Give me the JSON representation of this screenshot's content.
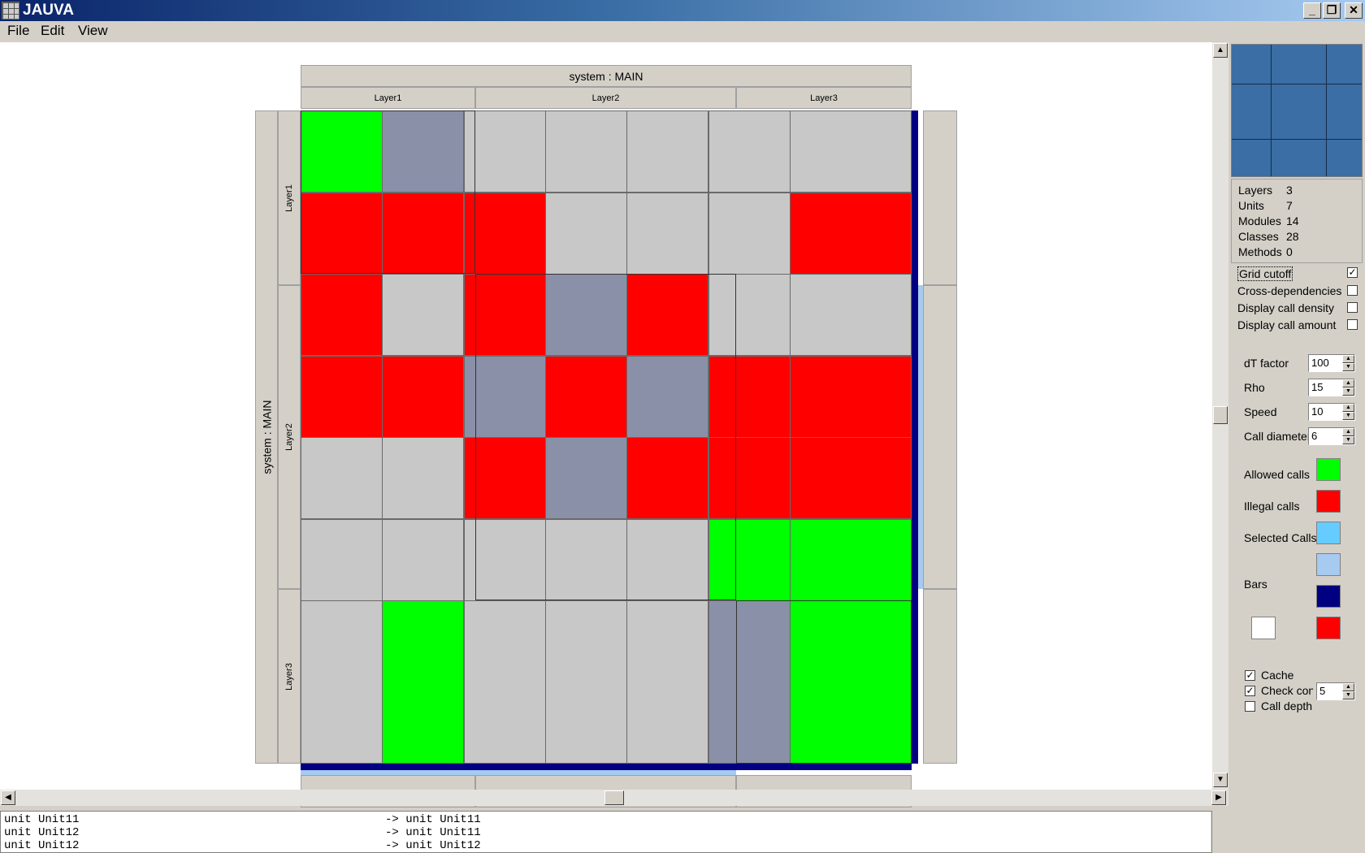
{
  "window": {
    "title": "JAUVA"
  },
  "menubar": {
    "items": [
      "File",
      "Edit",
      "View"
    ]
  },
  "matrix": {
    "system_title": "system : MAIN",
    "layers": [
      "Layer1",
      "Layer2",
      "Layer3"
    ],
    "cells": [
      [
        "allowed",
        "selected",
        "none",
        "none",
        "none",
        "none",
        "none"
      ],
      [
        "illegal",
        "illegal",
        "illegal",
        "none",
        "none",
        "none",
        "illegal"
      ],
      [
        "illegal",
        "none",
        "illegal",
        "selected",
        "illegal",
        "none",
        "none"
      ],
      [
        "illegal",
        "illegal",
        "selected",
        "illegal",
        "selected",
        "illegal",
        "illegal"
      ],
      [
        "none",
        "none",
        "illegal",
        "selected",
        "illegal",
        "illegal",
        "illegal"
      ],
      [
        "none",
        "none",
        "none",
        "none",
        "none",
        "allowed",
        "allowed"
      ],
      [
        "none",
        "allowed",
        "none",
        "none",
        "none",
        "selected",
        "allowed"
      ]
    ]
  },
  "stats": {
    "layers_label": "Layers",
    "layers_value": "3",
    "units_label": "Units",
    "units_value": "7",
    "modules_label": "Modules",
    "modules_value": "14",
    "classes_label": "Classes",
    "classes_value": "28",
    "methods_label": "Methods",
    "methods_value": "0"
  },
  "options": {
    "grid_cutoff": {
      "label": "Grid cutoff",
      "checked": true
    },
    "cross_dependencies": {
      "label": "Cross-dependencies",
      "checked": false
    },
    "display_call_density": {
      "label": "Display call density",
      "checked": false
    },
    "display_call_amount": {
      "label": "Display call amount",
      "checked": false
    }
  },
  "params": {
    "dt_factor": {
      "label": "dT factor",
      "value": "100"
    },
    "rho": {
      "label": "Rho",
      "value": "15"
    },
    "speed": {
      "label": "Speed",
      "value": "10"
    },
    "call_diameter": {
      "label": "Call diameter",
      "value": "6"
    }
  },
  "colors_panel": {
    "allowed_label": "Allowed calls",
    "illegal_label": "Illegal calls",
    "selected_label": "Selected Calls",
    "bars_label": "Bars"
  },
  "colors": {
    "allowed": "#00ff00",
    "illegal": "#ff0000",
    "none": "#c8c8c8",
    "selected": "#8a90a8",
    "selected_swatch": "#66ccff",
    "bars_light": "#a6caf0",
    "bars_dark": "#000080",
    "minimap": "#3a6ea5"
  },
  "bottom_options": {
    "cache": {
      "label": "Cache",
      "checked": true
    },
    "check_cons": {
      "label": "Check cons",
      "checked": true,
      "value": "5"
    },
    "call_depth": {
      "label": "Call depth",
      "checked": false
    }
  },
  "console": {
    "lines": [
      {
        "from": "unit Unit11",
        "to": "-> unit Unit11"
      },
      {
        "from": "unit Unit12",
        "to": "-> unit Unit11"
      },
      {
        "from": "unit Unit12",
        "to": "-> unit Unit12"
      }
    ]
  }
}
